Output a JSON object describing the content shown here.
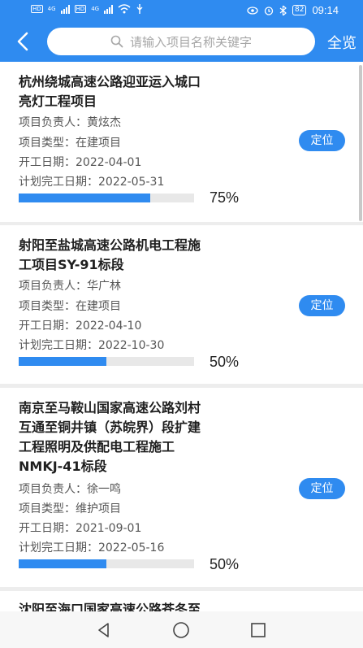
{
  "status_bar": {
    "sim_labels": [
      "HD",
      "HD"
    ],
    "network_labels": [
      "4G",
      "4G"
    ],
    "battery": "82",
    "time": "09:14"
  },
  "header": {
    "search_placeholder": "请输入项目名称关键字",
    "view_all_label": "全览"
  },
  "labels": {
    "manager": "项目负责人：",
    "type": "项目类型：",
    "start": "开工日期：",
    "planned_end": "计划完工日期：",
    "locate": "定位"
  },
  "projects": [
    {
      "title_lines": [
        "杭州绕城高速公路迎亚运入城口",
        "亮灯工程项目"
      ],
      "manager": "黄炫杰",
      "type": "在建项目",
      "start_date": "2022-04-01",
      "planned_end_date": "2022-05-31",
      "progress": 0.75,
      "progress_label": "75%"
    },
    {
      "title_lines": [
        "射阳至盐城高速公路机电工程施",
        "工项目SY-91标段"
      ],
      "manager": "华广林",
      "type": "在建项目",
      "start_date": "2022-04-10",
      "planned_end_date": "2022-10-30",
      "progress": 0.5,
      "progress_label": "50%"
    },
    {
      "title_lines": [
        "南京至马鞍山国家高速公路刘村",
        "互通至铜井镇（苏皖界）段扩建",
        "工程照明及供配电工程施工",
        "NMKJ-41标段"
      ],
      "manager": "徐一鸣",
      "type": "维护项目",
      "start_date": "2021-09-01",
      "planned_end_date": "2022-05-16",
      "progress": 0.5,
      "progress_label": "50%"
    },
    {
      "title_lines": [
        "沈阳至海口国家高速公路苍冬至"
      ]
    }
  ]
}
